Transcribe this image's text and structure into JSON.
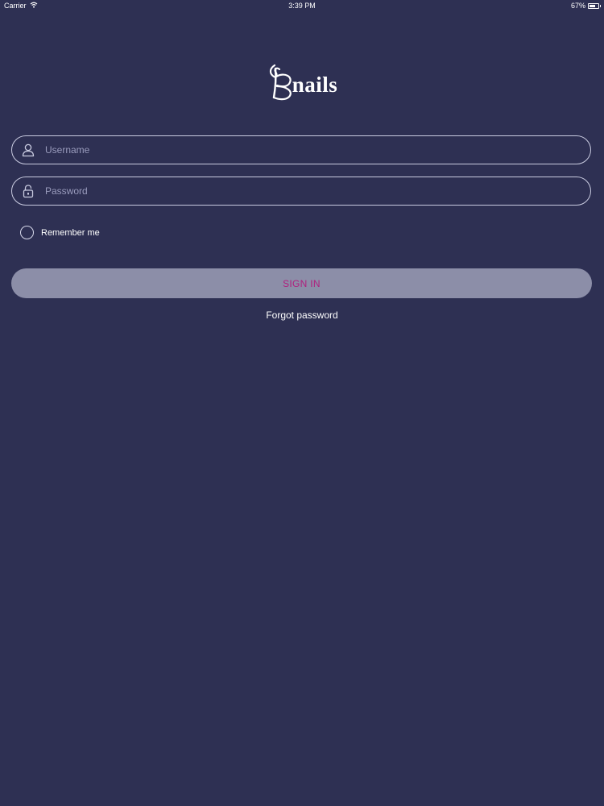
{
  "status_bar": {
    "carrier": "Carrier",
    "time": "3:39 PM",
    "battery_text": "67%",
    "battery_level": 0.67
  },
  "logo": {
    "text": "nails",
    "icon": "butterfly-b-logo-icon"
  },
  "form": {
    "username": {
      "placeholder": "Username",
      "value": "",
      "icon": "user-icon"
    },
    "password": {
      "placeholder": "Password",
      "value": "",
      "icon": "lock-icon"
    },
    "remember_me": {
      "label": "Remember me",
      "checked": false
    },
    "sign_in_label": "SIGN IN",
    "forgot_password_label": "Forgot password"
  },
  "colors": {
    "background": "#2e3053",
    "field_border": "#c9cbe0",
    "placeholder": "#9a9cbd",
    "button_bg": "#8c8ea8",
    "button_text": "#b0207e"
  }
}
